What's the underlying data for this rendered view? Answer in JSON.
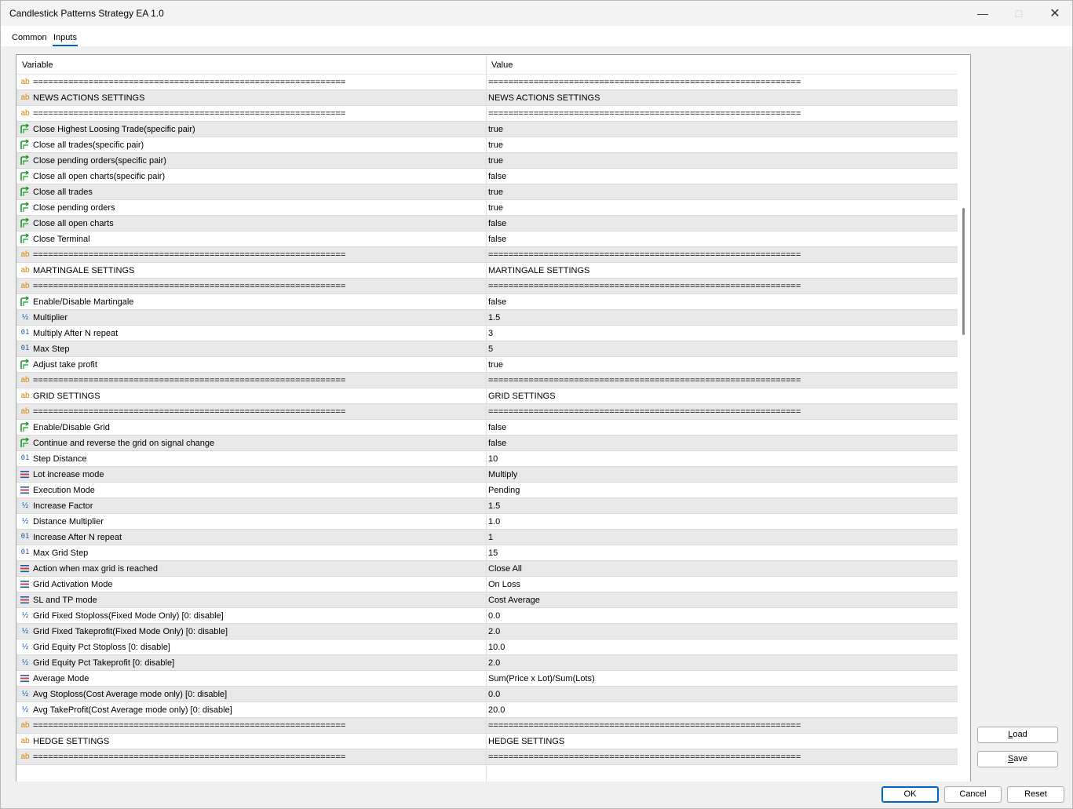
{
  "window": {
    "title": "Candlestick Patterns Strategy EA 1.0",
    "minimize_icon": "minimize-icon",
    "maximize_icon": "maximize-icon",
    "close_icon": "close-icon"
  },
  "tabs": [
    {
      "label": "Common",
      "active": false
    },
    {
      "label": "Inputs",
      "active": true
    }
  ],
  "table": {
    "headers": {
      "variable": "Variable",
      "value": "Value"
    },
    "rows": [
      {
        "icon": "ab",
        "variable": "==============================================================",
        "value": "=============================================================="
      },
      {
        "icon": "ab",
        "variable": "NEWS ACTIONS SETTINGS",
        "value": "NEWS ACTIONS SETTINGS"
      },
      {
        "icon": "ab",
        "variable": "==============================================================",
        "value": "=============================================================="
      },
      {
        "icon": "bool",
        "variable": "Close Highest Loosing Trade(specific pair)",
        "value": "true"
      },
      {
        "icon": "bool",
        "variable": "Close all trades(specific pair)",
        "value": "true"
      },
      {
        "icon": "bool",
        "variable": "Close pending orders(specific pair)",
        "value": "true"
      },
      {
        "icon": "bool",
        "variable": "Close all open charts(specific pair)",
        "value": "false"
      },
      {
        "icon": "bool",
        "variable": "Close all trades",
        "value": "true"
      },
      {
        "icon": "bool",
        "variable": "Close pending orders",
        "value": "true"
      },
      {
        "icon": "bool",
        "variable": "Close all open charts",
        "value": "false"
      },
      {
        "icon": "bool",
        "variable": "Close Terminal",
        "value": "false"
      },
      {
        "icon": "ab",
        "variable": "==============================================================",
        "value": "=============================================================="
      },
      {
        "icon": "ab",
        "variable": "MARTINGALE SETTINGS",
        "value": "MARTINGALE SETTINGS"
      },
      {
        "icon": "ab",
        "variable": "==============================================================",
        "value": "=============================================================="
      },
      {
        "icon": "bool",
        "variable": "Enable/Disable Martingale",
        "value": "false"
      },
      {
        "icon": "half",
        "variable": "Multiplier",
        "value": "1.5"
      },
      {
        "icon": "num01",
        "variable": "Multiply After N repeat",
        "value": "3"
      },
      {
        "icon": "num01",
        "variable": "Max Step",
        "value": "5"
      },
      {
        "icon": "bool",
        "variable": "Adjust take profit",
        "value": "true"
      },
      {
        "icon": "ab",
        "variable": "==============================================================",
        "value": "=============================================================="
      },
      {
        "icon": "ab",
        "variable": "GRID SETTINGS",
        "value": "GRID SETTINGS"
      },
      {
        "icon": "ab",
        "variable": "==============================================================",
        "value": "=============================================================="
      },
      {
        "icon": "bool",
        "variable": "Enable/Disable Grid",
        "value": "false"
      },
      {
        "icon": "bool",
        "variable": "Continue and reverse the grid on signal change",
        "value": "false"
      },
      {
        "icon": "num01",
        "variable": "Step Distance",
        "value": "10"
      },
      {
        "icon": "enum",
        "variable": "Lot increase mode",
        "value": "Multiply"
      },
      {
        "icon": "enum",
        "variable": "Execution Mode",
        "value": "Pending"
      },
      {
        "icon": "half",
        "variable": "Increase Factor",
        "value": "1.5"
      },
      {
        "icon": "half",
        "variable": "Distance Multiplier",
        "value": "1.0"
      },
      {
        "icon": "num01",
        "variable": "Increase After N repeat",
        "value": "1"
      },
      {
        "icon": "num01",
        "variable": "Max Grid Step",
        "value": "15"
      },
      {
        "icon": "enum",
        "variable": "Action when max grid is reached",
        "value": "Close All"
      },
      {
        "icon": "enum",
        "variable": "Grid Activation Mode",
        "value": "On Loss"
      },
      {
        "icon": "enum",
        "variable": "SL and TP mode",
        "value": "Cost Average"
      },
      {
        "icon": "half",
        "variable": "Grid Fixed Stoploss(Fixed Mode Only) [0: disable]",
        "value": "0.0"
      },
      {
        "icon": "half",
        "variable": "Grid Fixed Takeprofit(Fixed Mode Only) [0: disable]",
        "value": "2.0"
      },
      {
        "icon": "half",
        "variable": "Grid Equity Pct Stoploss [0: disable]",
        "value": "10.0"
      },
      {
        "icon": "half",
        "variable": "Grid Equity Pct Takeprofit [0: disable]",
        "value": "2.0"
      },
      {
        "icon": "enum",
        "variable": "Average Mode",
        "value": "Sum(Price x Lot)/Sum(Lots)"
      },
      {
        "icon": "half",
        "variable": "Avg Stoploss(Cost Average mode only) [0: disable]",
        "value": "0.0"
      },
      {
        "icon": "half",
        "variable": "Avg TakeProfit(Cost Average mode only) [0: disable]",
        "value": "20.0"
      },
      {
        "icon": "ab",
        "variable": "==============================================================",
        "value": "=============================================================="
      },
      {
        "icon": "ab",
        "variable": "HEDGE SETTINGS",
        "value": "HEDGE SETTINGS"
      },
      {
        "icon": "ab",
        "variable": "==============================================================",
        "value": "=============================================================="
      }
    ]
  },
  "side_buttons": {
    "load": "Load",
    "save": "Save"
  },
  "footer_buttons": {
    "ok": "OK",
    "cancel": "Cancel",
    "reset": "Reset"
  },
  "colors": {
    "accent": "#0067c0",
    "string_icon": "#d98200",
    "numeric_icon": "#1f5aa6",
    "bool_icon": "#1a9a2a",
    "row_alt": "#e8e8e8"
  }
}
